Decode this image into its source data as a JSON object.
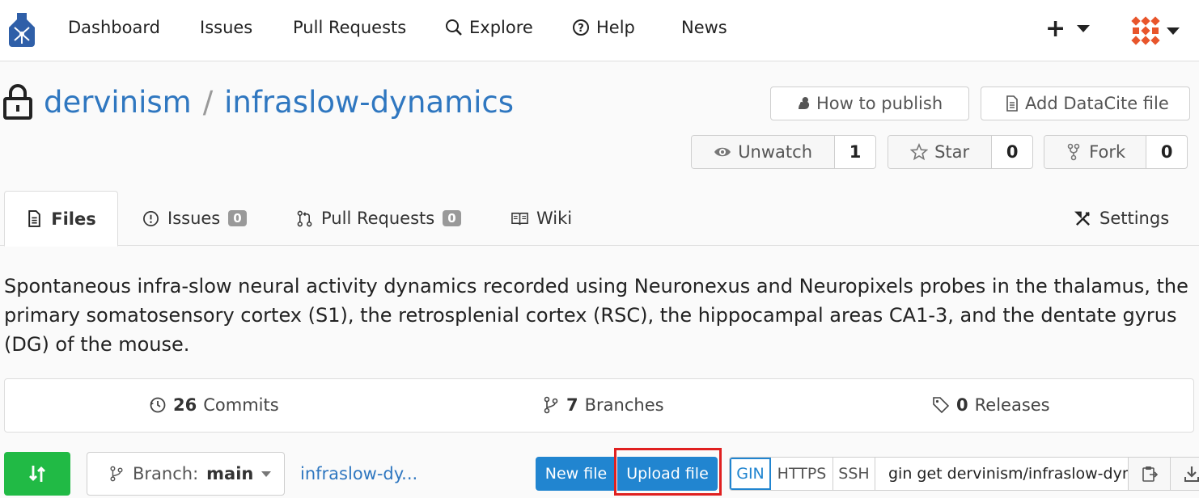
{
  "nav": {
    "items": [
      {
        "label": "Dashboard"
      },
      {
        "label": "Issues"
      },
      {
        "label": "Pull Requests"
      },
      {
        "label": "Explore"
      },
      {
        "label": "Help"
      },
      {
        "label": "News"
      }
    ],
    "plus_label": "+"
  },
  "repo": {
    "owner": "dervinism",
    "separator": "/",
    "name": "infraslow-dynamics",
    "how_to_publish": "How to publish",
    "add_datacite": "Add DataCite file",
    "watch": {
      "label": "Unwatch",
      "count": "1"
    },
    "star": {
      "label": "Star",
      "count": "0"
    },
    "fork": {
      "label": "Fork",
      "count": "0"
    }
  },
  "tabs": [
    {
      "label": "Files"
    },
    {
      "label": "Issues",
      "badge": "0"
    },
    {
      "label": "Pull Requests",
      "badge": "0"
    },
    {
      "label": "Wiki"
    },
    {
      "label": "Settings"
    }
  ],
  "description": "Spontaneous infra-slow neural activity dynamics recorded using Neuronexus and Neuropixels probes in the thalamus, the primary somatosensory cortex (S1), the retrosplenial cortex (RSC), the hippocampal areas CA1-3, and the dentate gyrus (DG) of the mouse.",
  "stats": {
    "commits": {
      "count": "26",
      "label": "Commits"
    },
    "branches": {
      "count": "7",
      "label": "Branches"
    },
    "releases": {
      "count": "0",
      "label": "Releases"
    }
  },
  "toolbar": {
    "branch_prefix": "Branch:",
    "branch_name": "main",
    "repo_link": "infraslow-dy...",
    "new_file": "New file",
    "upload_file": "Upload file",
    "protocols": [
      "GIN",
      "HTTPS",
      "SSH"
    ],
    "clone_value": "gin get dervinism/infraslow-dynamics"
  },
  "colors": {
    "link": "#2f77c0",
    "primary": "#2185d0",
    "success": "#21ba45",
    "highlight": "#e02020"
  }
}
